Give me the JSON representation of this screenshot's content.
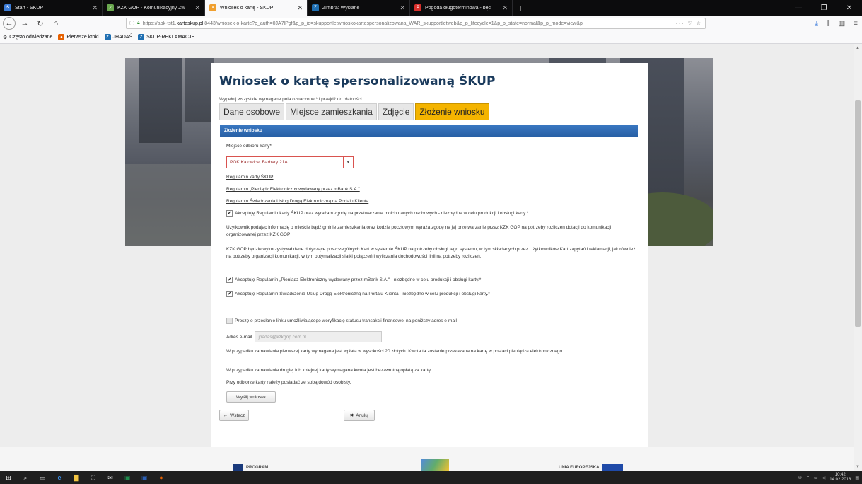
{
  "browser": {
    "tabs": [
      {
        "label": "Start - ŚKUP",
        "favicon_color": "#3d7dd8",
        "favicon_glyph": "S",
        "active": false
      },
      {
        "label": "KZK GOP - Komunikacyjny Zw",
        "favicon_color": "#6aa84f",
        "favicon_glyph": "✓",
        "active": false
      },
      {
        "label": "Wniosek o kartę - ŚKUP",
        "favicon_color": "#f0a030",
        "favicon_glyph": "•",
        "active": true
      },
      {
        "label": "Zimbra: Wysłane",
        "favicon_color": "#1f6fb2",
        "favicon_glyph": "Z",
        "active": false
      },
      {
        "label": "Pogoda długoterminowa - bęc",
        "favicon_color": "#d9302c",
        "favicon_glyph": "P",
        "active": false
      }
    ],
    "url_prefix": "https://apk-tst1.",
    "url_host": "kartaskup.pl",
    "url_rest": ":8443/wniosek-o-karte?p_auth=0JA7lPgf&p_p_id=skupportletwnioskokartespersonalizowana_WAR_skupportletweb&p_p_lifecycle=1&p_p_state=normal&p_p_mode=view&p",
    "url_extras": "··· ♡ ☆",
    "bookmarks": [
      "Często odwiedzane",
      "Pierwsze kroki",
      "JHADAŚ",
      "SKUP-REKLAMACJE"
    ]
  },
  "form": {
    "title": "Wniosek o kartę spersonalizowaną ŚKUP",
    "hint": "Wypełnij wszystkie wymagane pola oznaczone * i przejdź do płatności.",
    "steps": [
      "Dane osobowe",
      "Miejsce zamieszkania",
      "Zdjęcie",
      "Złożenie wniosku"
    ],
    "section_title": "Złożenie wniosku",
    "pickup_label": "Miejsce odbioru karty*",
    "pickup_value": "POK Katowice, Barbary 21A",
    "links": [
      "Regulamin karty ŚKUP",
      "Regulamin „Pieniądz Elektroniczny wydawany przez mBank S.A.\"",
      "Regulamin Świadczenia Usług Drogą Elektroniczną na Portalu Klienta"
    ],
    "consent1": "Akceptuję Regulamin karty ŚKUP oraz wyrażam zgodę na przetwarzanie moich danych osobowych - niezbędne w celu produkcji i obsługi karty.*",
    "info1": "Użytkownik podając informację o mieście bądź gminie zamieszkania oraz kodzie pocztowym wyraża zgodę na jej przetwarzanie przez KZK GOP na potrzeby rozliczeń dotacji do komunikacji organizowanej przez KZK GOP",
    "info2": "KZK GOP będzie wykorzystywał dane dotyczące poszczególnych Kart w systemie ŚKUP na potrzeby obsługi tego systemu, w tym składanych przez Użytkowników Kart zapytań i reklamacji, jak również na potrzeby organizacji komunikacji, w tym optymalizacji siatki połączeń i wyliczania dochodowości linii na potrzeby rozliczeń.",
    "consent2": "Akceptuję Regulamin „Pieniądz Elektroniczny wydawany przez mBank S.A.\" - niezbędne w celu produkcji i obsługi karty.*",
    "consent3": "Akceptuję Regulamin Świadczenia Usług Drogą Elektroniczną na Portalu Klienta - niezbędne w celu produkcji i obsługi karty.*",
    "email_request": "Proszę o przesłanie linku umożliwiającego weryfikację statusu transakcji finansowej na poniższy adres e-mail",
    "email_label": "Adres e-mail",
    "email_value": "jhadas@kzkgop.com.pl",
    "note1": "W przypadku zamawiania pierwszej karty wymagana jest wpłata w wysokości 20 złotych. Kwota ta zostanie przekazana na kartę w postaci pieniądza elektronicznego.",
    "note2": "W przypadku zamawiania drugiej lub kolejnej karty wymagana kwota jest bezzwrotną opłatą za kartę.",
    "note3": "Przy odbiorze karty należy posiadać ze sobą dowód osobisty.",
    "submit_label": "Wyślij wniosek",
    "back_label": "Wstecz",
    "cancel_label": "Anuluj"
  },
  "footer": {
    "logo1": "PROGRAM",
    "logo3": "UNIA EUROPEJSKA"
  },
  "taskbar": {
    "time": "10:42",
    "date": "14.02.2018"
  }
}
